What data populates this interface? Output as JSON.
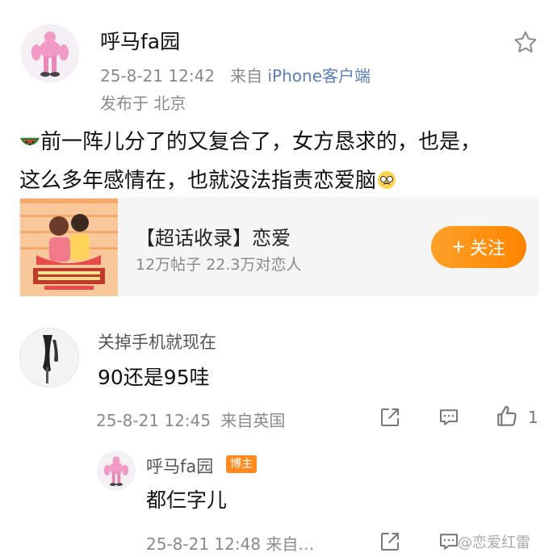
{
  "post": {
    "username": "呼马fa园",
    "date": "25-8-21 12:42",
    "source_prefix": "来自 ",
    "source_app": "iPhone客户端",
    "location": "发布于 北京",
    "body_line1": "前一阵儿分了的又复合了，女方恳求的，也是，",
    "body_line2": "这么多年感情在，也就没法指责恋爱脑"
  },
  "topic_card": {
    "title": "【超话收录】恋爱",
    "stats": "12万帖子 22.3万对恋人",
    "follow_label": "关注",
    "follow_icon": "+"
  },
  "comment": {
    "username": "关掉手机就现在",
    "text": "90还是95哇",
    "date": "25-8-21 12:45",
    "source": "来自英国",
    "like_count": "1"
  },
  "reply": {
    "username": "呼马fa园",
    "badge": "博主",
    "text": "都仨字儿",
    "meta": "25-8-21 12:48  来自…"
  },
  "watermark": "@恋爱红雷",
  "colors": {
    "link_blue": "#5b7fb6",
    "follow_orange": "#ff8400",
    "badge_orange": "#ff8a1f"
  }
}
